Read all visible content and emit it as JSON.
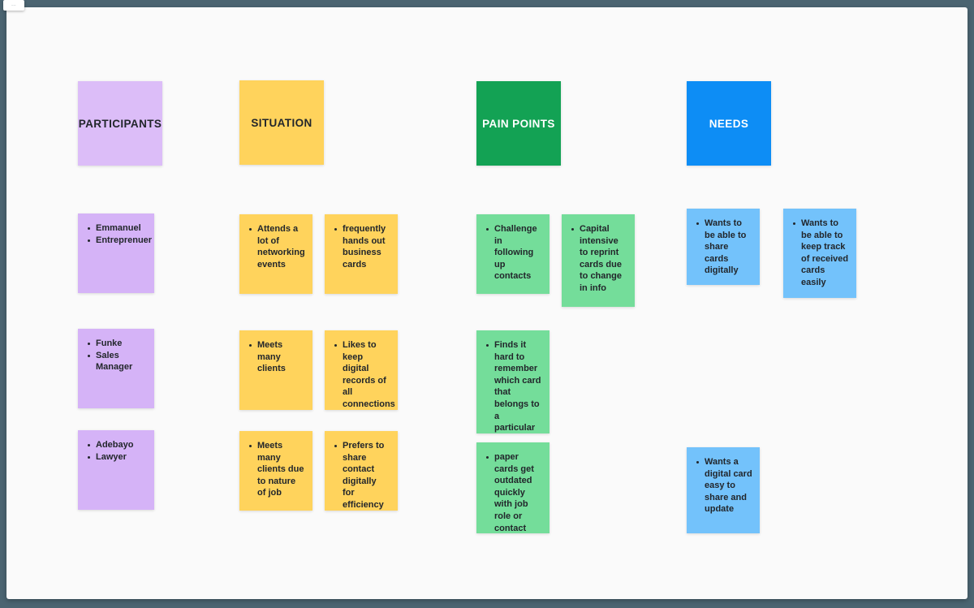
{
  "toolbar": {
    "text": "·····"
  },
  "board": {
    "background_color": "#4b6471",
    "canvas_color": "#fafafa"
  },
  "columns": [
    {
      "id": "participants",
      "header": {
        "label": "PARTICIPANTS",
        "color": "#dcbdf8",
        "text_color": "#22262b"
      },
      "note_color": "#d5b3f7",
      "notes": [
        {
          "items": [
            "Emmanuel",
            "Entreprenuer"
          ]
        },
        {
          "items": [
            "Funke",
            "Sales Manager"
          ]
        },
        {
          "items": [
            "Adebayo",
            "Lawyer"
          ]
        }
      ]
    },
    {
      "id": "situation",
      "header": {
        "label": "SITUATION",
        "color": "#ffd35c",
        "text_color": "#22262b"
      },
      "note_color": "#ffd35c",
      "notes": [
        {
          "items": [
            "Attends a lot of networking events"
          ]
        },
        {
          "items": [
            "frequently hands out business cards"
          ]
        },
        {
          "items": [
            "Meets many clients"
          ]
        },
        {
          "items": [
            "Likes to keep digital records of all connections"
          ]
        },
        {
          "items": [
            "Meets many clients due to nature of job"
          ]
        },
        {
          "items": [
            "Prefers to share contact digitally for efficiency"
          ]
        }
      ]
    },
    {
      "id": "pain-points",
      "header": {
        "label": "PAIN POINTS",
        "color": "#13a254",
        "text_color": "#ffffff"
      },
      "note_color": "#74dd9a",
      "notes": [
        {
          "items": [
            "Challenge in following up contacts"
          ]
        },
        {
          "items": [
            "Capital intensive to reprint cards due to change in info"
          ]
        },
        {
          "items": [
            "Finds it hard to remember which card that belongs to a particular connection"
          ]
        },
        {
          "items": [
            "paper cards get outdated quickly with job role or contact changes"
          ]
        }
      ]
    },
    {
      "id": "needs",
      "header": {
        "label": "NEEDS",
        "color": "#0d8df5",
        "text_color": "#ffffff"
      },
      "note_color": "#73c2fb",
      "notes": [
        {
          "items": [
            "Wants to be able to share cards digitally"
          ]
        },
        {
          "items": [
            "Wants to be able to keep track of received cards easily"
          ]
        },
        {
          "items": [
            "Wants a digital card easy to share and update"
          ]
        }
      ]
    }
  ]
}
